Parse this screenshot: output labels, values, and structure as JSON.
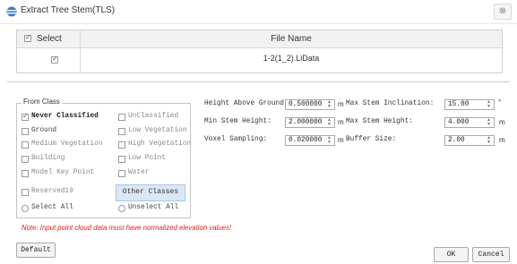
{
  "window": {
    "title": "Extract Tree Stem(TLS)",
    "close_glyph": "⊗",
    "title_icon": "app-logo-icon"
  },
  "file_table": {
    "col_select": "Select",
    "col_filename": "File Name",
    "rows": [
      {
        "selected": true,
        "file_name": "1-2(1_2).LiData"
      }
    ]
  },
  "from_class": {
    "legend": "From Class",
    "items": [
      {
        "label": "Never Classified",
        "checked": true
      },
      {
        "label": "UnClassified",
        "checked": false
      },
      {
        "label": "Ground",
        "checked": false
      },
      {
        "label": "Low Vegetation",
        "checked": false
      },
      {
        "label": "Medium Vegetation",
        "checked": false
      },
      {
        "label": "High Vegetation",
        "checked": false
      },
      {
        "label": "Building",
        "checked": false
      },
      {
        "label": "Low Point",
        "checked": false
      },
      {
        "label": "Model Key Point",
        "checked": false
      },
      {
        "label": "Water",
        "checked": false
      },
      {
        "label": "Reserved19",
        "checked": false
      }
    ],
    "other_classes": "Other Classes",
    "select_all": "Select All",
    "unselect_all": "Unselect All"
  },
  "params": {
    "height_above_ground": {
      "label": "Height Above Ground:",
      "value": "0.500000",
      "unit": "m"
    },
    "min_stem_height": {
      "label": "Min Stem Height:",
      "value": "2.000000",
      "unit": "m"
    },
    "voxel_sampling": {
      "label": "Voxel Sampling:",
      "value": "0.020000",
      "unit": "m"
    },
    "max_stem_inclination": {
      "label": "Max Stem Inclination:",
      "value": "15.00",
      "unit": "°"
    },
    "max_stem_height": {
      "label": "Max Stem Height:",
      "value": "4.000",
      "unit": "m"
    },
    "buffer_size": {
      "label": "Buffer Size:",
      "value": "2.00",
      "unit": "m"
    }
  },
  "note": "Note: Input point cloud data must have normalized elevation values!",
  "buttons": {
    "default": "Default",
    "ok": "OK",
    "cancel": "Cancel"
  }
}
